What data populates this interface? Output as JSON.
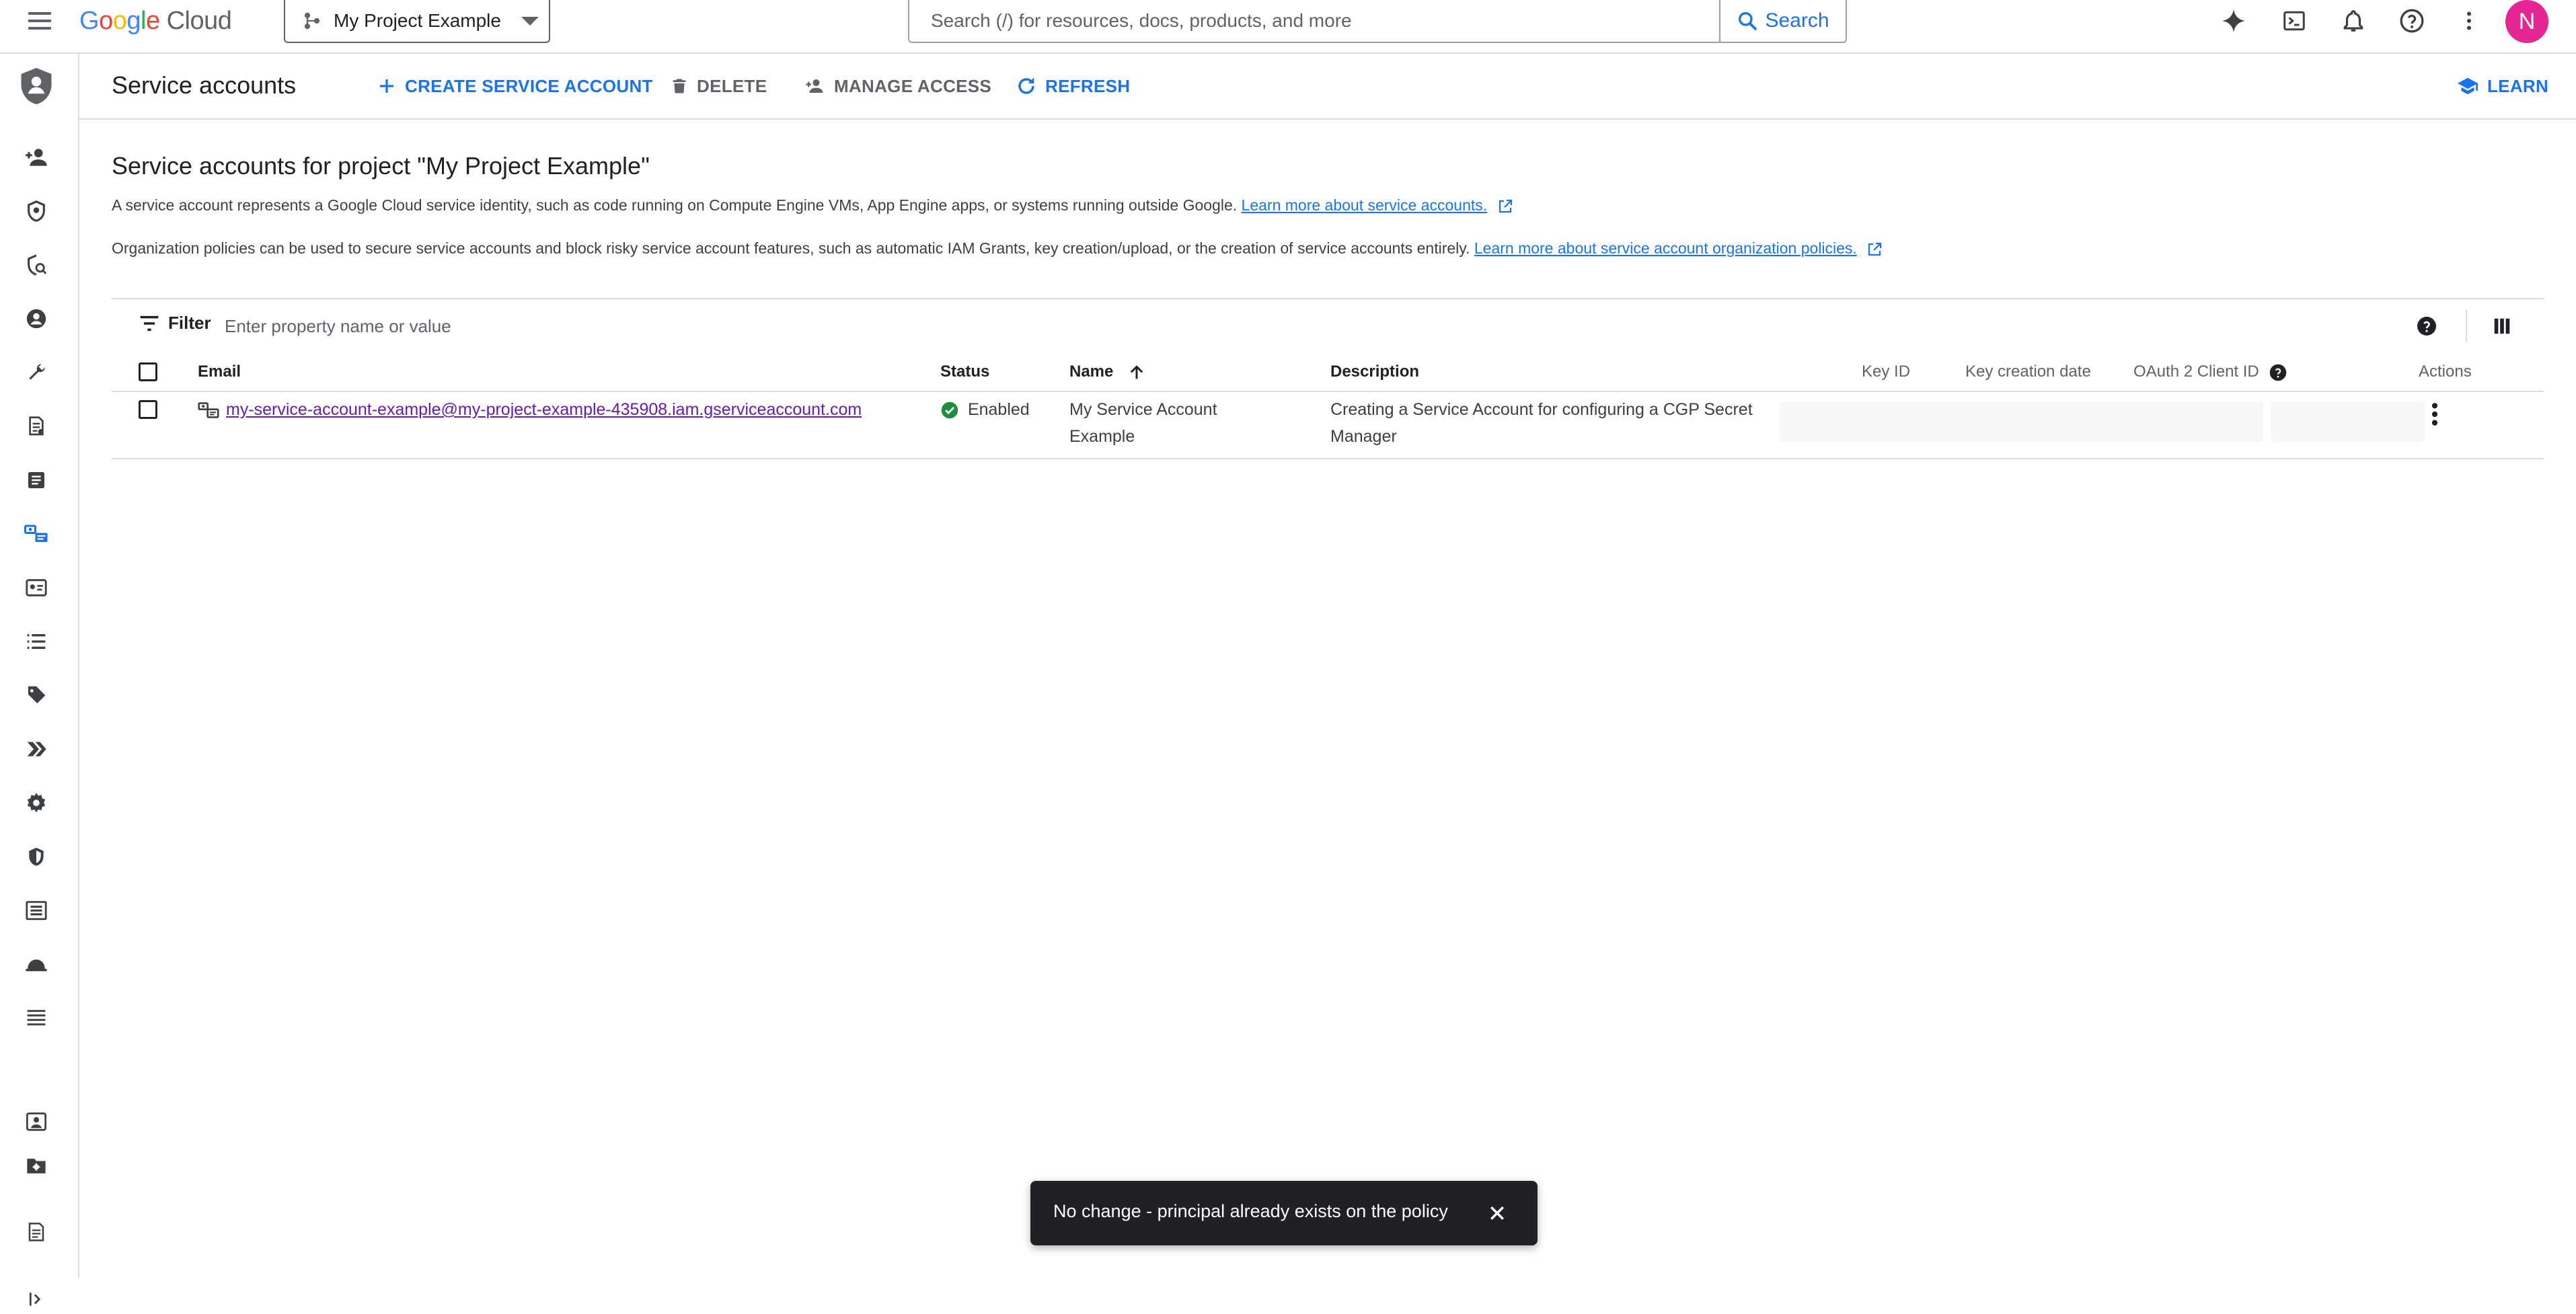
{
  "brand": {
    "logo_letters": [
      "G",
      "o",
      "o",
      "g",
      "l",
      "e"
    ],
    "product": "Cloud"
  },
  "project_picker": {
    "label": "My Project Example"
  },
  "search": {
    "placeholder": "Search (/) for resources, docs, products, and more",
    "button_label": "Search"
  },
  "top_icons": [
    "gemini-icon",
    "cloud-shell-icon",
    "notifications-icon",
    "help-icon",
    "more-vert-icon"
  ],
  "user": {
    "avatar_letter": "N",
    "avatar_color": "#e52592"
  },
  "rail_icons": [
    "iam-shield-icon",
    "person-add-icon",
    "security-shield-icon",
    "policy-icon",
    "account-circle-icon",
    "wrench-icon",
    "policy-document-icon",
    "audit-logs-icon",
    "service-accounts-icon",
    "workload-identity-icon",
    "list-icon",
    "tags-icon",
    "label-icon",
    "settings-icon",
    "privacy-shield-icon",
    "organization-policies-icon",
    "deny-icon",
    "grouped-list-icon",
    "essential-contacts-icon",
    "secure-folder-icon",
    "release-notes-icon",
    "expand-rail-icon"
  ],
  "header": {
    "title": "Service accounts",
    "actions": {
      "create": "CREATE SERVICE ACCOUNT",
      "delete": "DELETE",
      "manage": "MANAGE ACCESS",
      "refresh": "REFRESH",
      "learn": "LEARN"
    }
  },
  "content": {
    "title": "Service accounts for project \"My Project Example\"",
    "para1_text": "A service account represents a Google Cloud service identity, such as code running on Compute Engine VMs, App Engine apps, or systems running outside Google.",
    "para1_link": "Learn more about service accounts.",
    "para2_text": "Organization policies can be used to secure service accounts and block risky service account features, such as automatic IAM Grants, key creation/upload, or the creation of service accounts entirely.",
    "para2_link": "Learn more about service account organization policies."
  },
  "filter": {
    "label": "Filter",
    "placeholder": "Enter property name or value"
  },
  "table": {
    "columns": {
      "email": "Email",
      "status": "Status",
      "name": "Name",
      "description": "Description",
      "key_id": "Key ID",
      "key_date": "Key creation date",
      "oauth": "OAuth 2 Client ID",
      "actions": "Actions"
    },
    "sort": {
      "column": "Name",
      "direction": "ascending"
    },
    "rows": [
      {
        "email": "my-service-account-example@my-project-example-435908.iam.gserviceaccount.com",
        "status": "Enabled",
        "name_line1": "My Service Account",
        "name_line2": "Example",
        "description_line1": "Creating a Service Account for configuring a CGP Secret",
        "description_line2": "Manager"
      }
    ]
  },
  "snackbar": {
    "message": "No change - principal already exists on the policy"
  },
  "colors": {
    "accent": "#1a73e8",
    "status_ok": "#1e8e3e",
    "visited_link": "#681da8",
    "snackbar_bg": "#202124"
  }
}
